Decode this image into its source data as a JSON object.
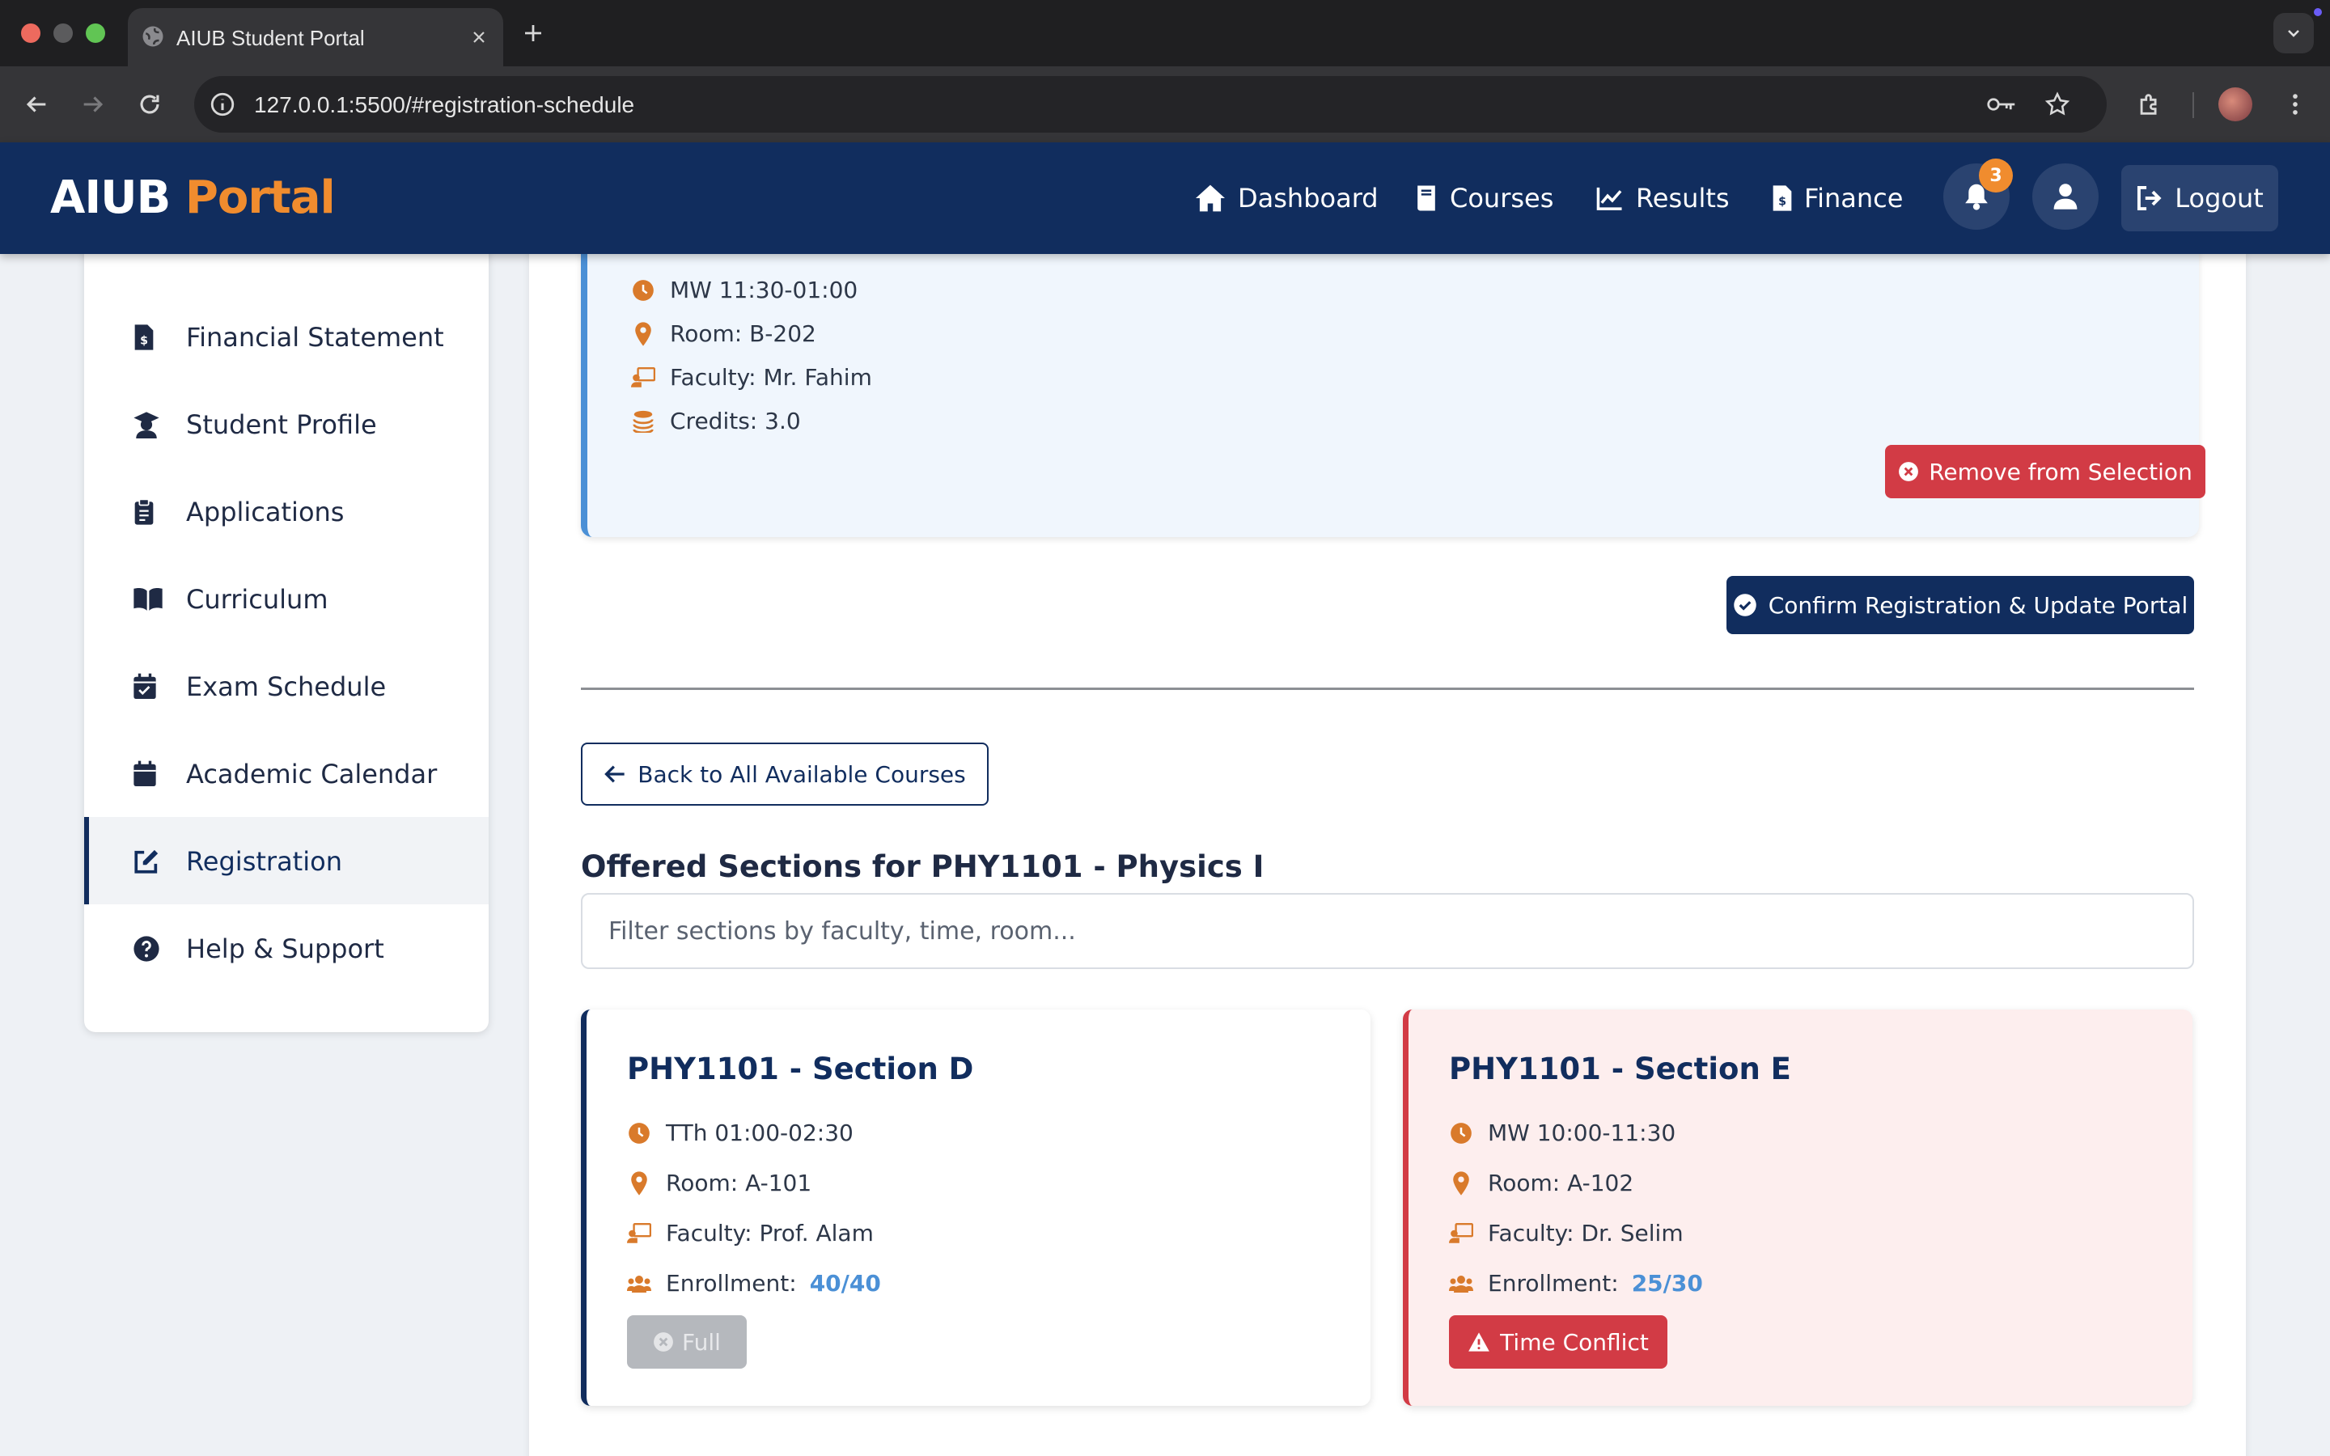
{
  "browser": {
    "tab_title": "AIUB Student Portal",
    "url": "127.0.0.1:5500/#registration-schedule"
  },
  "header": {
    "brand_primary": "AIUB",
    "brand_secondary": "Portal",
    "nav": [
      {
        "label": "Dashboard",
        "icon": "home-icon"
      },
      {
        "label": "Courses",
        "icon": "book-icon"
      },
      {
        "label": "Results",
        "icon": "chart-line-icon"
      },
      {
        "label": "Finance",
        "icon": "invoice-icon"
      }
    ],
    "notification_count": "3",
    "logout_label": "Logout"
  },
  "sidebar": {
    "items": [
      {
        "label": "Financial Statement",
        "icon": "invoice-icon"
      },
      {
        "label": "Student Profile",
        "icon": "graduate-icon"
      },
      {
        "label": "Applications",
        "icon": "clipboard-icon"
      },
      {
        "label": "Curriculum",
        "icon": "open-book-icon"
      },
      {
        "label": "Exam Schedule",
        "icon": "calendar-check-icon"
      },
      {
        "label": "Academic Calendar",
        "icon": "calendar-icon"
      },
      {
        "label": "Registration",
        "icon": "edit-icon",
        "active": true
      },
      {
        "label": "Help & Support",
        "icon": "question-circle-icon"
      }
    ]
  },
  "selected_course": {
    "schedule": "MW 11:30-01:00",
    "room": "Room: B-202",
    "faculty": "Faculty: Mr. Fahim",
    "credits": "Credits: 3.0",
    "remove_label": "Remove from Selection"
  },
  "confirm_label": "Confirm Registration & Update Portal",
  "back_label": "Back to All Available Courses",
  "sections_title": "Offered Sections for PHY1101 - Physics I",
  "filter_placeholder": "Filter sections by faculty, time, room...",
  "sections": [
    {
      "title": "PHY1101 - Section D",
      "schedule": "TTh 01:00-02:30",
      "room": "Room: A-101",
      "faculty": "Faculty: Prof. Alam",
      "enrollment_label": "Enrollment:",
      "enrollment_value": "40/40",
      "status_label": "Full"
    },
    {
      "title": "PHY1101 - Section E",
      "schedule": "MW 10:00-11:30",
      "room": "Room: A-102",
      "faculty": "Faculty: Dr. Selim",
      "enrollment_label": "Enrollment:",
      "enrollment_value": "25/30",
      "status_label": "Time Conflict"
    }
  ],
  "colors": {
    "navy": "#112d5e",
    "accent_orange": "#f08c2e",
    "danger": "#d23b45",
    "info_blue": "#4b90d6"
  }
}
